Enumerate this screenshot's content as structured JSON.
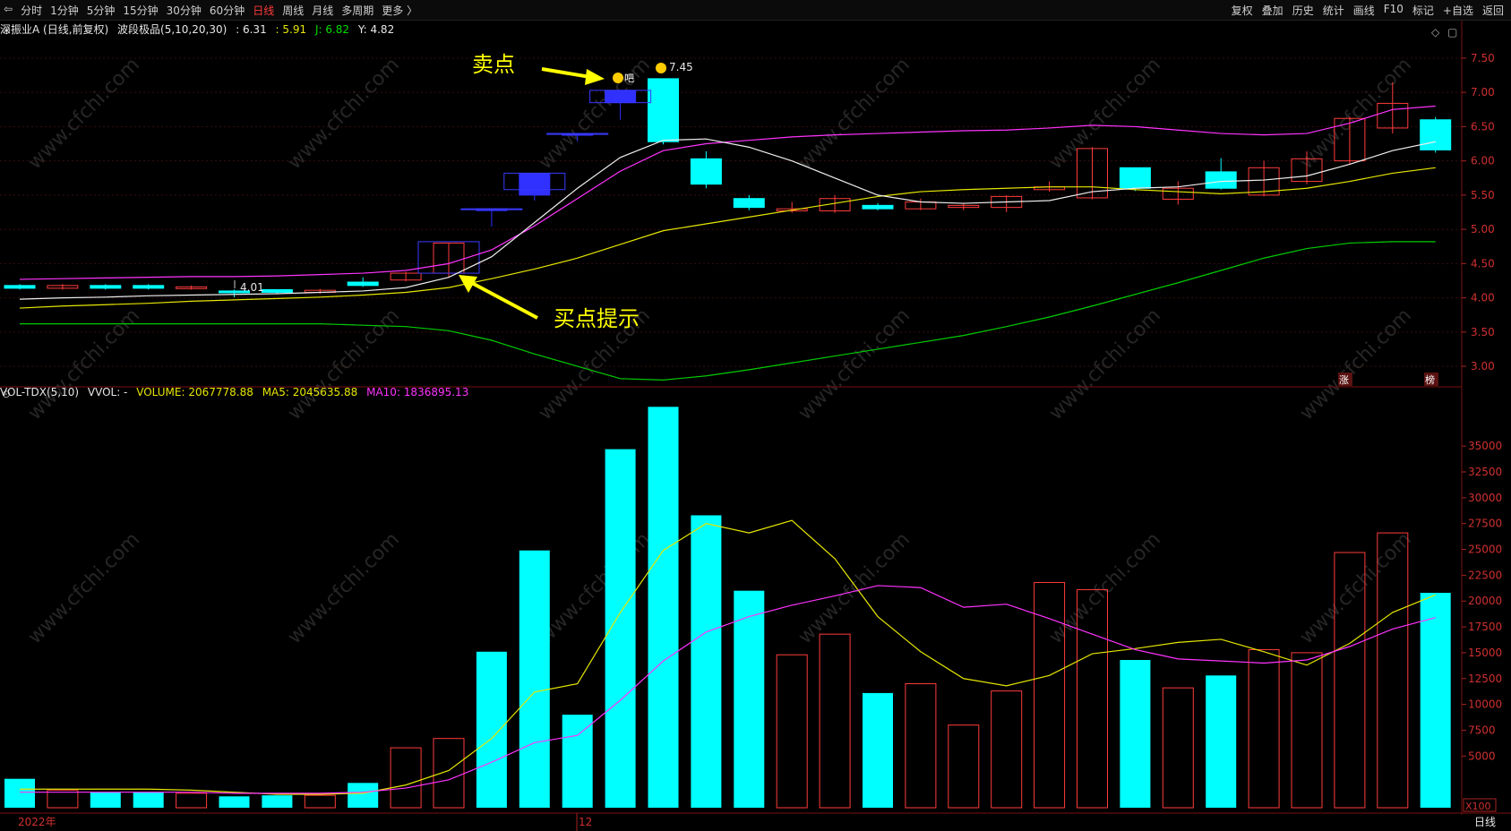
{
  "toolbar": {
    "back_icon": "back-arrow-icon",
    "periods": [
      "分时",
      "1分钟",
      "5分钟",
      "15分钟",
      "30分钟",
      "60分钟",
      "日线",
      "周线",
      "月线",
      "多周期",
      "更多 〉"
    ],
    "active_period": "日线",
    "tools": [
      "复权",
      "叠加",
      "历史",
      "统计",
      "画线",
      "F10",
      "标记",
      "+自选",
      "返回"
    ]
  },
  "price_panel": {
    "stock": "深振业A (日线,前复权)",
    "indicator": "波段极品(5,10,20,30)",
    "v1": ": 6.31",
    "v2": ": 5.91",
    "j": "J: 6.82",
    "y": "Y: 4.82",
    "colors": {
      "v1": "#e8e8e8",
      "v2": "#e6e600",
      "j": "#00dd00",
      "y": "#e8e8e8"
    }
  },
  "vol_panel": {
    "name": "VOL-TDX(5,10)",
    "vvol": "VVOL: -",
    "volume": "VOLUME: 2067778.88",
    "ma5": "MA5: 2045635.88",
    "ma10": "MA10: 1836895.13",
    "unit": "X100"
  },
  "annotations": {
    "sell": "卖点",
    "buy": "买点提示",
    "high_label": "7.45",
    "low_label": "4.01",
    "emoji_text": "吧",
    "tag_rise": "涨",
    "tag_list": "榜"
  },
  "axis": {
    "price_ticks": [
      "7.50",
      "7.00",
      "6.50",
      "6.00",
      "5.50",
      "5.00",
      "4.50",
      "4.00",
      "3.50",
      "3.00"
    ],
    "vol_ticks": [
      "35000",
      "32500",
      "30000",
      "27500",
      "25000",
      "22500",
      "20000",
      "17500",
      "15000",
      "12500",
      "10000",
      "7500",
      "5000"
    ],
    "date_labels": [
      "2022年",
      "12"
    ],
    "period_label": "日线"
  },
  "watermark": "www.cfchi.com",
  "chart_data": {
    "type": "candlestick",
    "price_range": [
      2.7,
      7.8
    ],
    "volume_range": [
      0,
      39000
    ],
    "candles": [
      {
        "o": 4.18,
        "c": 4.14,
        "h": 4.2,
        "l": 4.12,
        "v": 2800
      },
      {
        "o": 4.14,
        "c": 4.18,
        "h": 4.2,
        "l": 4.12,
        "v": 1700
      },
      {
        "o": 4.18,
        "c": 4.14,
        "h": 4.2,
        "l": 4.12,
        "v": 1500
      },
      {
        "o": 4.18,
        "c": 4.14,
        "h": 4.2,
        "l": 4.12,
        "v": 1500
      },
      {
        "o": 4.14,
        "c": 4.16,
        "h": 4.18,
        "l": 4.12,
        "v": 1400
      },
      {
        "o": 4.1,
        "c": 4.08,
        "h": 4.12,
        "l": 4.01,
        "v": 1100
      },
      {
        "o": 4.12,
        "c": 4.08,
        "h": 4.12,
        "l": 4.06,
        "v": 1200
      },
      {
        "o": 4.08,
        "c": 4.11,
        "h": 4.13,
        "l": 4.06,
        "v": 1200
      },
      {
        "o": 4.23,
        "c": 4.18,
        "h": 4.3,
        "l": 4.16,
        "v": 2400
      },
      {
        "o": 4.26,
        "c": 4.36,
        "h": 4.38,
        "l": 4.24,
        "v": 5800
      },
      {
        "o": 4.36,
        "c": 4.8,
        "h": 4.8,
        "l": 4.3,
        "v": 6700
      },
      {
        "o": 5.3,
        "c": 5.3,
        "h": 5.3,
        "l": 5.04,
        "v": 15100
      },
      {
        "o": 5.82,
        "c": 5.5,
        "h": 5.82,
        "l": 5.42,
        "v": 24900
      },
      {
        "o": 6.4,
        "c": 6.4,
        "h": 6.4,
        "l": 6.28,
        "v": 9000
      },
      {
        "o": 7.03,
        "c": 6.85,
        "h": 7.03,
        "l": 6.6,
        "v": 34700
      },
      {
        "o": 7.2,
        "c": 6.28,
        "h": 7.2,
        "l": 6.24,
        "v": 38800
      },
      {
        "o": 6.03,
        "c": 5.66,
        "h": 6.14,
        "l": 5.6,
        "v": 28300
      },
      {
        "o": 5.45,
        "c": 5.32,
        "h": 5.5,
        "l": 5.28,
        "v": 21000
      },
      {
        "o": 5.27,
        "c": 5.3,
        "h": 5.4,
        "l": 5.24,
        "v": 14800
      },
      {
        "o": 5.27,
        "c": 5.45,
        "h": 5.5,
        "l": 5.24,
        "v": 16800
      },
      {
        "o": 5.35,
        "c": 5.3,
        "h": 5.38,
        "l": 5.28,
        "v": 11100
      },
      {
        "o": 5.3,
        "c": 5.4,
        "h": 5.45,
        "l": 5.28,
        "v": 12000
      },
      {
        "o": 5.32,
        "c": 5.35,
        "h": 5.38,
        "l": 5.28,
        "v": 8000
      },
      {
        "o": 5.32,
        "c": 5.48,
        "h": 5.5,
        "l": 5.25,
        "v": 11300
      },
      {
        "o": 5.58,
        "c": 5.62,
        "h": 5.7,
        "l": 5.55,
        "v": 21800
      },
      {
        "o": 5.46,
        "c": 6.18,
        "h": 6.2,
        "l": 5.44,
        "v": 21100
      },
      {
        "o": 5.9,
        "c": 5.6,
        "h": 5.9,
        "l": 5.56,
        "v": 14300
      },
      {
        "o": 5.44,
        "c": 5.6,
        "h": 5.7,
        "l": 5.36,
        "v": 11600
      },
      {
        "o": 5.84,
        "c": 5.6,
        "h": 6.04,
        "l": 5.58,
        "v": 12800
      },
      {
        "o": 5.5,
        "c": 5.9,
        "h": 6.0,
        "l": 5.48,
        "v": 15300
      },
      {
        "o": 5.7,
        "c": 6.03,
        "h": 6.14,
        "l": 5.66,
        "v": 15000
      },
      {
        "o": 6.0,
        "c": 6.62,
        "h": 6.64,
        "l": 5.95,
        "v": 24700
      },
      {
        "o": 6.48,
        "c": 6.84,
        "h": 7.15,
        "l": 6.4,
        "v": 26600
      },
      {
        "o": 6.6,
        "c": 6.16,
        "h": 6.64,
        "l": 6.12,
        "v": 20800
      }
    ],
    "line_white": [
      3.98,
      4.0,
      4.01,
      4.03,
      4.04,
      4.05,
      4.06,
      4.08,
      4.1,
      4.15,
      4.3,
      4.6,
      5.1,
      5.6,
      6.05,
      6.3,
      6.32,
      6.2,
      6.0,
      5.75,
      5.5,
      5.4,
      5.38,
      5.4,
      5.42,
      5.55,
      5.6,
      5.62,
      5.7,
      5.72,
      5.78,
      5.95,
      6.15,
      6.28
    ],
    "line_yellow": [
      3.85,
      3.88,
      3.9,
      3.92,
      3.95,
      3.97,
      3.99,
      4.01,
      4.04,
      4.08,
      4.15,
      4.28,
      4.42,
      4.58,
      4.78,
      4.98,
      5.08,
      5.18,
      5.28,
      5.38,
      5.48,
      5.55,
      5.58,
      5.6,
      5.62,
      5.62,
      5.58,
      5.55,
      5.52,
      5.55,
      5.6,
      5.7,
      5.82,
      5.9
    ],
    "line_magenta": [
      4.27,
      4.28,
      4.29,
      4.3,
      4.31,
      4.31,
      4.32,
      4.34,
      4.36,
      4.4,
      4.5,
      4.7,
      5.05,
      5.45,
      5.85,
      6.15,
      6.25,
      6.3,
      6.35,
      6.38,
      6.4,
      6.42,
      6.44,
      6.45,
      6.48,
      6.52,
      6.5,
      6.45,
      6.4,
      6.38,
      6.4,
      6.55,
      6.75,
      6.8
    ],
    "line_green": [
      3.62,
      3.62,
      3.62,
      3.62,
      3.62,
      3.62,
      3.62,
      3.62,
      3.6,
      3.58,
      3.52,
      3.38,
      3.18,
      3.0,
      2.82,
      2.8,
      2.86,
      2.95,
      3.05,
      3.15,
      3.25,
      3.35,
      3.45,
      3.58,
      3.72,
      3.88,
      4.05,
      4.22,
      4.4,
      4.58,
      4.72,
      4.8,
      4.82,
      4.82
    ],
    "vol_ma5": [
      1800,
      1800,
      1800,
      1800,
      1700,
      1500,
      1300,
      1300,
      1400,
      2200,
      3600,
      6700,
      11200,
      12000,
      18900,
      24900,
      27500,
      26600,
      27800,
      24100,
      18500,
      15100,
      12500,
      11800,
      12800,
      14900,
      15400,
      16000,
      16300,
      15100,
      13800,
      15900,
      18900,
      20600
    ],
    "vol_ma10": [
      1500,
      1500,
      1500,
      1500,
      1500,
      1400,
      1400,
      1400,
      1500,
      1900,
      2700,
      4400,
      6300,
      7000,
      10400,
      14200,
      17000,
      18500,
      19600,
      20500,
      21500,
      21300,
      19400,
      19700,
      18300,
      16800,
      15300,
      14400,
      14200,
      14000,
      14300,
      15600,
      17300,
      18400
    ]
  }
}
